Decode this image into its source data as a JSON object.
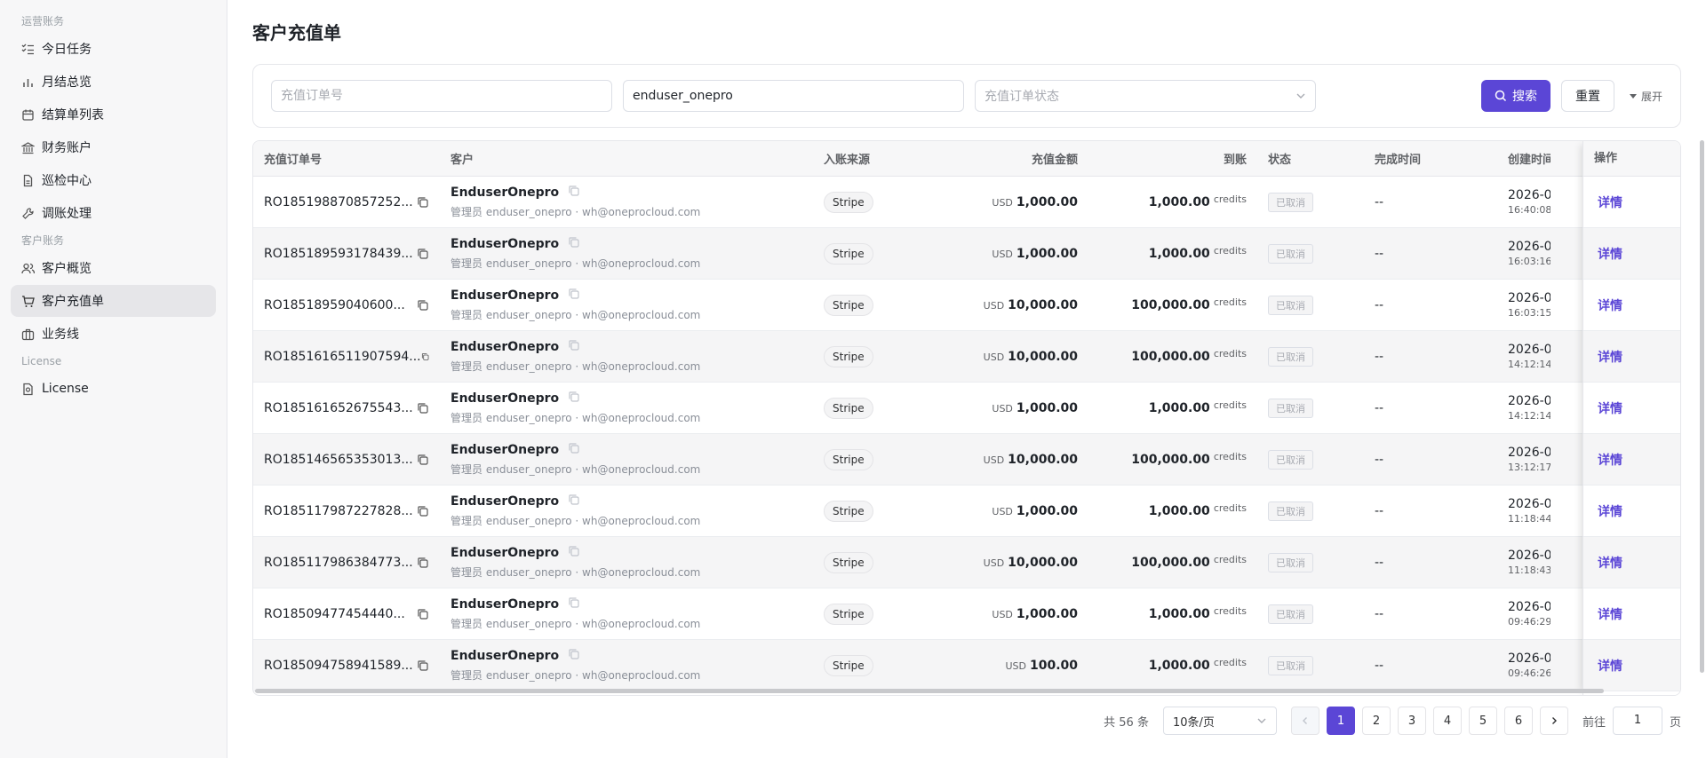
{
  "sidebar": {
    "group1": "运营账务",
    "items1": [
      {
        "label": "今日任务",
        "icon": "list-check-icon"
      },
      {
        "label": "月结总览",
        "icon": "bar-chart-icon"
      },
      {
        "label": "结算单列表",
        "icon": "calendar-icon"
      },
      {
        "label": "财务账户",
        "icon": "bank-icon"
      },
      {
        "label": "巡检中心",
        "icon": "document-icon"
      },
      {
        "label": "调账处理",
        "icon": "wrench-icon"
      }
    ],
    "group2": "客户账务",
    "items2": [
      {
        "label": "客户概览",
        "icon": "users-icon"
      },
      {
        "label": "客户充值单",
        "icon": "cart-icon"
      },
      {
        "label": "业务线",
        "icon": "briefcase-icon"
      }
    ],
    "group3": "License",
    "items3": [
      {
        "label": "License",
        "icon": "license-icon"
      }
    ]
  },
  "page": {
    "title": "客户充值单"
  },
  "search": {
    "order_placeholder": "充值订单号",
    "customer_value": "enduser_onepro",
    "status_placeholder": "充值订单状态",
    "search_label": "搜索",
    "reset_label": "重置",
    "expand_label": "展开"
  },
  "table": {
    "headers": {
      "order_id": "充值订单号",
      "customer": "客户",
      "source": "入账来源",
      "amount": "充值金额",
      "credits": "到账",
      "status": "状态",
      "completed": "完成时间",
      "created": "创建时间",
      "action": "操作"
    },
    "rows": [
      {
        "order_id": "RO185198870857252...",
        "name": "EnduserOnepro",
        "role": "管理员",
        "sub": "enduser_onepro · wh@oneprocloud.com",
        "source": "Stripe",
        "currency": "USD",
        "amount": "1,000.00",
        "credits": "1,000.00",
        "unit": "credits",
        "status": "已取消",
        "completed": "--",
        "created_date": "2026-0",
        "created_time": "16:40:08",
        "action": "详情"
      },
      {
        "order_id": "RO185189593178439...",
        "name": "EnduserOnepro",
        "role": "管理员",
        "sub": "enduser_onepro · wh@oneprocloud.com",
        "source": "Stripe",
        "currency": "USD",
        "amount": "1,000.00",
        "credits": "1,000.00",
        "unit": "credits",
        "status": "已取消",
        "completed": "--",
        "created_date": "2026-0",
        "created_time": "16:03:16",
        "action": "详情"
      },
      {
        "order_id": "RO18518959040600...",
        "name": "EnduserOnepro",
        "role": "管理员",
        "sub": "enduser_onepro · wh@oneprocloud.com",
        "source": "Stripe",
        "currency": "USD",
        "amount": "10,000.00",
        "credits": "100,000.00",
        "unit": "credits",
        "status": "已取消",
        "completed": "--",
        "created_date": "2026-0",
        "created_time": "16:03:15",
        "action": "详情"
      },
      {
        "order_id": "RO1851616511907594...",
        "name": "EnduserOnepro",
        "role": "管理员",
        "sub": "enduser_onepro · wh@oneprocloud.com",
        "source": "Stripe",
        "currency": "USD",
        "amount": "10,000.00",
        "credits": "100,000.00",
        "unit": "credits",
        "status": "已取消",
        "completed": "--",
        "created_date": "2026-0",
        "created_time": "14:12:14",
        "action": "详情"
      },
      {
        "order_id": "RO185161652675543...",
        "name": "EnduserOnepro",
        "role": "管理员",
        "sub": "enduser_onepro · wh@oneprocloud.com",
        "source": "Stripe",
        "currency": "USD",
        "amount": "1,000.00",
        "credits": "1,000.00",
        "unit": "credits",
        "status": "已取消",
        "completed": "--",
        "created_date": "2026-0",
        "created_time": "14:12:14",
        "action": "详情"
      },
      {
        "order_id": "RO185146565353013...",
        "name": "EnduserOnepro",
        "role": "管理员",
        "sub": "enduser_onepro · wh@oneprocloud.com",
        "source": "Stripe",
        "currency": "USD",
        "amount": "10,000.00",
        "credits": "100,000.00",
        "unit": "credits",
        "status": "已取消",
        "completed": "--",
        "created_date": "2026-0",
        "created_time": "13:12:17",
        "action": "详情"
      },
      {
        "order_id": "RO185117987227828...",
        "name": "EnduserOnepro",
        "role": "管理员",
        "sub": "enduser_onepro · wh@oneprocloud.com",
        "source": "Stripe",
        "currency": "USD",
        "amount": "1,000.00",
        "credits": "1,000.00",
        "unit": "credits",
        "status": "已取消",
        "completed": "--",
        "created_date": "2026-0",
        "created_time": "11:18:44",
        "action": "详情"
      },
      {
        "order_id": "RO185117986384773...",
        "name": "EnduserOnepro",
        "role": "管理员",
        "sub": "enduser_onepro · wh@oneprocloud.com",
        "source": "Stripe",
        "currency": "USD",
        "amount": "10,000.00",
        "credits": "100,000.00",
        "unit": "credits",
        "status": "已取消",
        "completed": "--",
        "created_date": "2026-0",
        "created_time": "11:18:43",
        "action": "详情"
      },
      {
        "order_id": "RO18509477454440...",
        "name": "EnduserOnepro",
        "role": "管理员",
        "sub": "enduser_onepro · wh@oneprocloud.com",
        "source": "Stripe",
        "currency": "USD",
        "amount": "1,000.00",
        "credits": "1,000.00",
        "unit": "credits",
        "status": "已取消",
        "completed": "--",
        "created_date": "2026-0",
        "created_time": "09:46:29",
        "action": "详情"
      },
      {
        "order_id": "RO185094758941589...",
        "name": "EnduserOnepro",
        "role": "管理员",
        "sub": "enduser_onepro · wh@oneprocloud.com",
        "source": "Stripe",
        "currency": "USD",
        "amount": "100.00",
        "credits": "1,000.00",
        "unit": "credits",
        "status": "已取消",
        "completed": "--",
        "created_date": "2026-0",
        "created_time": "09:46:26",
        "action": "详情"
      }
    ]
  },
  "pagination": {
    "total": "共 56 条",
    "page_size": "10条/页",
    "pages": [
      "1",
      "2",
      "3",
      "4",
      "5",
      "6"
    ],
    "current": "1",
    "goto_label": "前往",
    "goto_value": "1",
    "page_suffix": "页"
  },
  "colors": {
    "accent": "#5b46d6",
    "sidebar_bg": "#f7f7f8",
    "active_item": "#e6e6e9"
  }
}
